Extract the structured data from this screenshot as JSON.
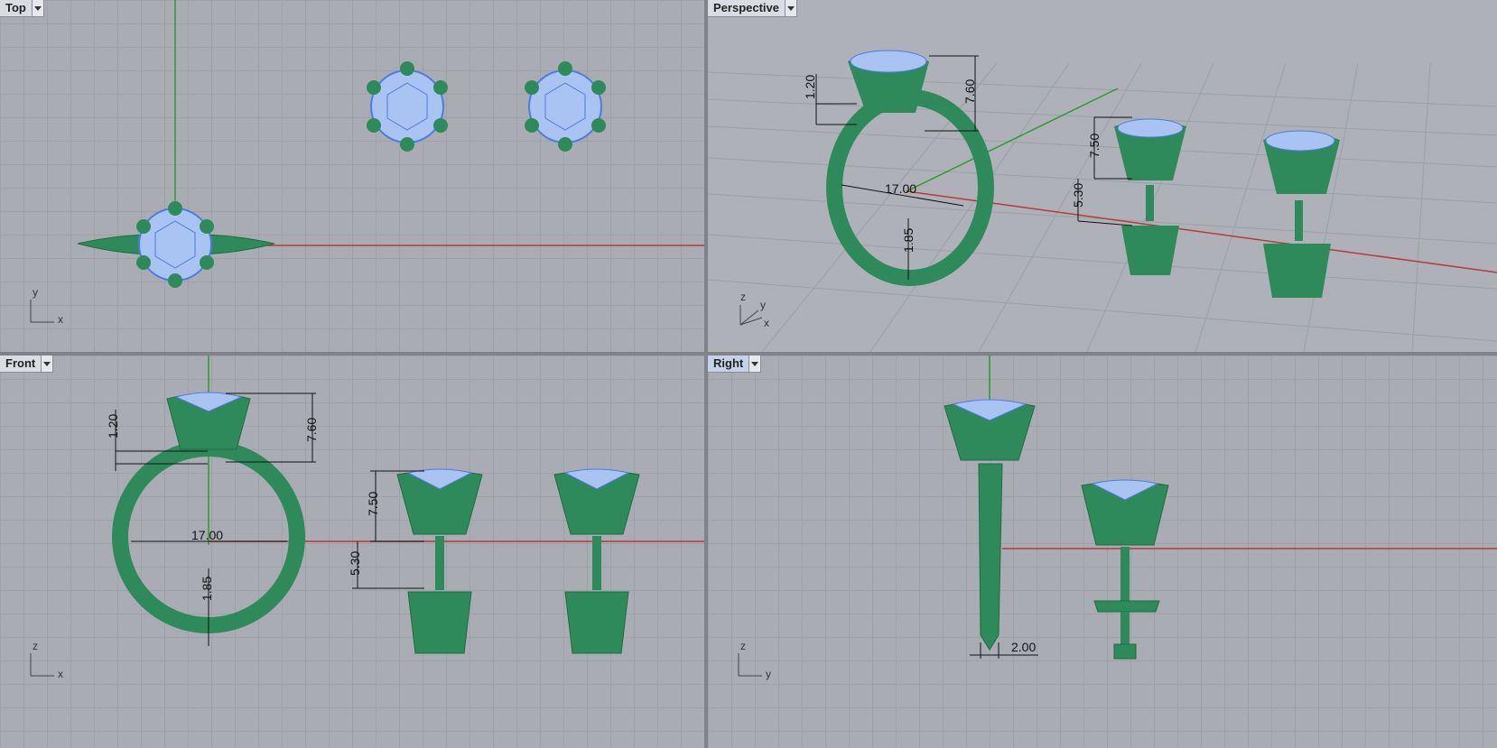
{
  "viewports": {
    "top": {
      "title": "Top",
      "axis_x": "x",
      "axis_y": "y"
    },
    "perspective": {
      "title": "Perspective",
      "axis_x": "x",
      "axis_y": "y",
      "axis_z": "z"
    },
    "front": {
      "title": "Front",
      "axis_x": "x",
      "axis_y": "z"
    },
    "right": {
      "title": "Right",
      "axis_x": "y",
      "axis_y": "z",
      "active": true
    }
  },
  "dimensions": {
    "head_height": "7.60",
    "shoulder": "1.20",
    "ring_inner": "17.00",
    "band_thickness": "1.85",
    "earring_head": "7.50",
    "earring_post": "5.30",
    "band_width": "2.00"
  },
  "colors": {
    "metal": "#2e8a5a",
    "metal_dark": "#1f6b42",
    "gem": "#a9c3f2",
    "gem_edge": "#4f7be0",
    "x_axis": "#b83a3a",
    "y_axis": "#2f9a2f"
  }
}
